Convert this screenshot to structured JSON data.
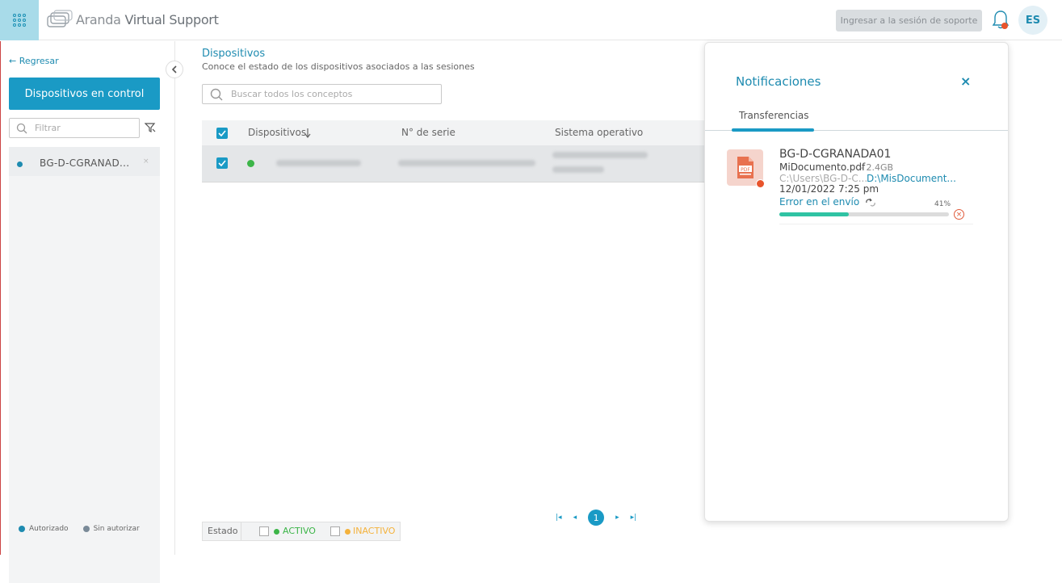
{
  "header": {
    "app_name_light": "Aranda",
    "app_name_bold": "Virtual Support",
    "support_button": "Ingresar a la sesión de soporte",
    "lang": "ES"
  },
  "sidebar": {
    "back": "← Regresar",
    "primary_button": "Dispositivos en control",
    "filter_placeholder": "Filtrar",
    "devices": [
      {
        "name": "BG-D-CGRANAD...",
        "status": "Autorizado"
      }
    ],
    "legend": [
      {
        "label": "Autorizado",
        "color": "#1e8bb0"
      },
      {
        "label": "Sin autorizar",
        "color": "#7a8a98"
      }
    ]
  },
  "main": {
    "title": "Dispositivos",
    "subtitle": "Conoce el estado de los dispositivos asociados a las sesiones",
    "search_placeholder": "Buscar todos los conceptos",
    "columns": [
      "Dispositivos",
      "N° de serie",
      "Sistema operativo"
    ],
    "sort_icon": "arrow-down-icon",
    "pager": {
      "first": "|◂",
      "prev": "◂",
      "current": "1",
      "next": "▸",
      "last": "▸|"
    },
    "status_filter": {
      "label": "Estado",
      "active": "ACTIVO",
      "inactive": "INACTIVO",
      "active_color": "#3cb548",
      "inactive_color": "#f4b23c"
    }
  },
  "notifications": {
    "title": "Notificaciones",
    "close": "×",
    "tab": "Transferencias",
    "items": [
      {
        "host": "BG-D-CGRANADA01",
        "file": "MiDocumento.pdf",
        "size": "- 2.4GB",
        "source": "C:\\Users\\BG-D-C...",
        "destination": "D:\\MisDocument...",
        "date": "12/01/2022 7:25 pm",
        "status": "Error en el envío",
        "progress": 41,
        "progress_label": "41%"
      }
    ]
  },
  "colors": {
    "accent": "#1a9ac5",
    "progress": "#2fc3a3",
    "error": "#e8542c"
  }
}
